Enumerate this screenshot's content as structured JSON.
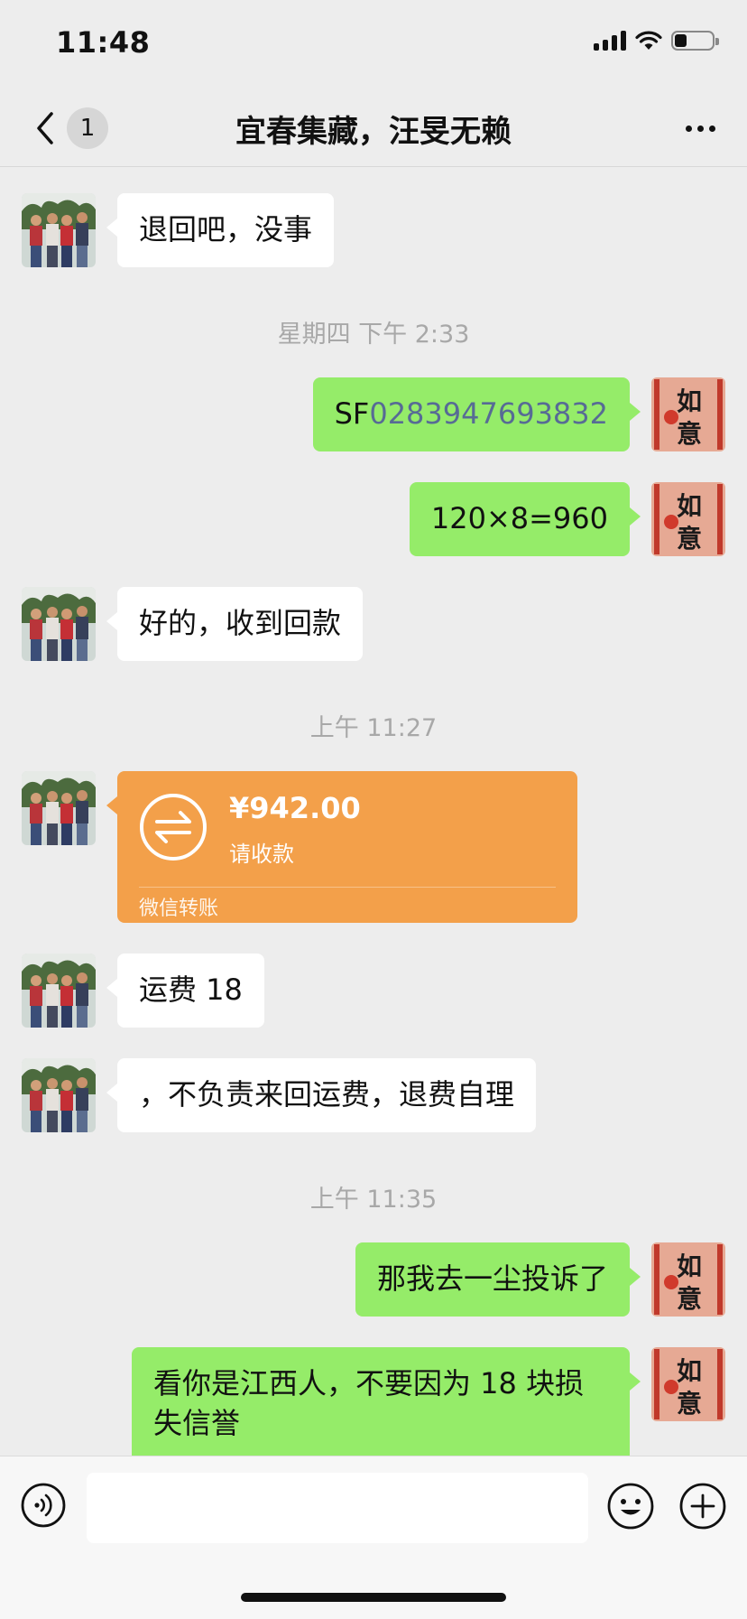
{
  "status_bar": {
    "time": "11:48"
  },
  "nav": {
    "unread_count": "1",
    "title": "宜春集藏，汪旻无赖"
  },
  "messages": [
    {
      "side": "in",
      "text": "退回吧，没事"
    },
    {
      "timestamp": "星期四 下午 2:33"
    },
    {
      "side": "out",
      "prefix": "SF",
      "link": "0283947693832"
    },
    {
      "side": "out",
      "text": "120×8=960"
    },
    {
      "side": "in",
      "text": "好的，收到回款"
    },
    {
      "timestamp": "上午 11:27"
    },
    {
      "side": "in",
      "type": "transfer",
      "amount": "¥942.00",
      "status": "请收款",
      "footer": "微信转账"
    },
    {
      "side": "in",
      "text": "运费 18"
    },
    {
      "side": "in",
      "text": "，不负责来回运费，退费自理"
    },
    {
      "timestamp": "上午 11:35"
    },
    {
      "side": "out",
      "text": "那我去一尘投诉了"
    },
    {
      "side": "out",
      "text": "看你是江西人，不要因为 18 块损失信誉"
    }
  ],
  "self_avatar": {
    "char_top": "如",
    "char_bottom": "意"
  },
  "input": {
    "value": ""
  },
  "colors": {
    "bubble_out": "#95ec69",
    "transfer": "#f3a04a",
    "link": "#576b95"
  }
}
